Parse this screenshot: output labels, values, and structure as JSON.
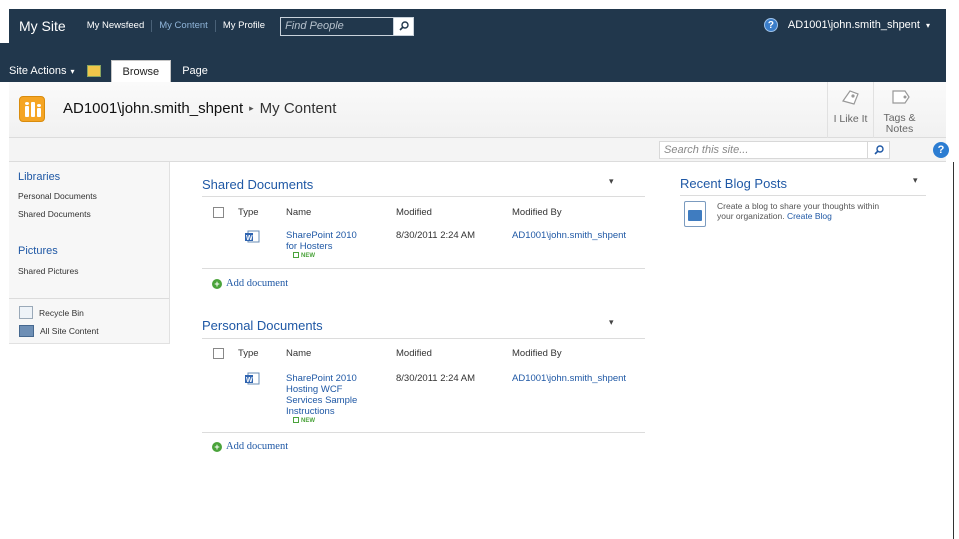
{
  "topbar": {
    "site_title": "My Site",
    "nav": [
      "My Newsfeed",
      "My Content",
      "My Profile"
    ],
    "find_people_placeholder": "Find People",
    "user_name": "AD1001\\john.smith_shpent",
    "user_menu_arrow": "▾",
    "help_icon": "?"
  },
  "ribbon": {
    "site_actions": "Site Actions",
    "site_actions_arrow": "▾",
    "tabs": [
      "Browse",
      "Page"
    ]
  },
  "title_area": {
    "breadcrumb_user": "AD1001\\john.smith_shpent",
    "breadcrumb_sep": "▸",
    "breadcrumb_page": "My Content",
    "i_like_it": "I Like It",
    "tags_notes_1": "Tags &",
    "tags_notes_2": "Notes"
  },
  "search": {
    "placeholder": "Search this site...",
    "help_icon": "?"
  },
  "quick_launch": {
    "libraries_heading": "Libraries",
    "libraries": [
      "Personal Documents",
      "Shared Documents"
    ],
    "pictures_heading": "Pictures",
    "pictures": [
      "Shared Pictures"
    ],
    "recycle_bin": "Recycle Bin",
    "all_site_content": "All Site Content"
  },
  "shared_documents": {
    "title": "Shared Documents",
    "menu_arrow": "▾",
    "columns": [
      "Type",
      "Name",
      "Modified",
      "Modified By"
    ],
    "rows": [
      {
        "name_lines": [
          "SharePoint 2010",
          "for Hosters"
        ],
        "new_badge": "NEW",
        "modified": "8/30/2011 2:24 AM",
        "modified_by": "AD1001\\john.smith_shpent"
      }
    ],
    "add_document": "Add document"
  },
  "personal_documents": {
    "title": "Personal Documents",
    "menu_arrow": "▾",
    "columns": [
      "Type",
      "Name",
      "Modified",
      "Modified By"
    ],
    "rows": [
      {
        "name_lines": [
          "SharePoint 2010",
          "Hosting WCF",
          "Services Sample",
          "Instructions"
        ],
        "new_badge": "NEW",
        "modified": "8/30/2011 2:24 AM",
        "modified_by": "AD1001\\john.smith_shpent"
      }
    ],
    "add_document": "Add document"
  },
  "recent_blog_posts": {
    "title": "Recent Blog Posts",
    "menu_arrow": "▾",
    "text_1": "Create a blog to share your thoughts within",
    "text_2": "your organization.",
    "create_link": "Create Blog"
  }
}
